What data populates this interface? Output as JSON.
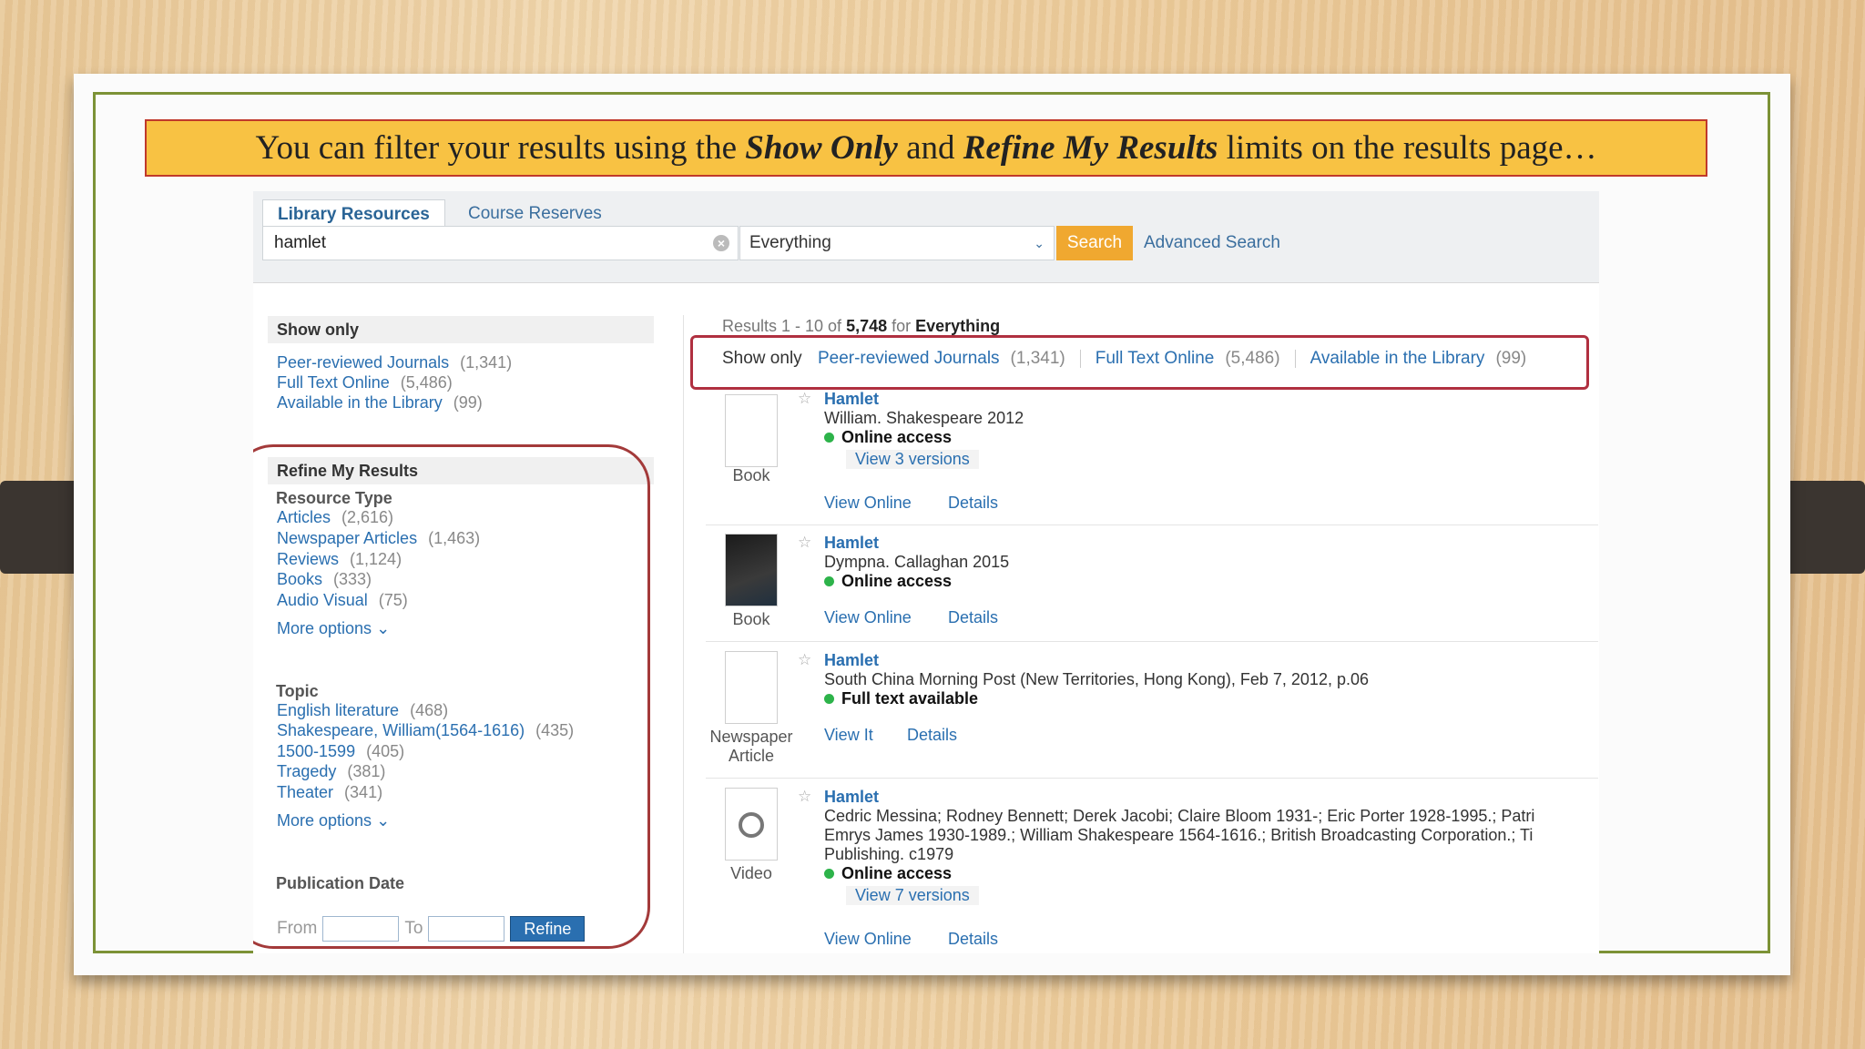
{
  "banner": {
    "pre": "You can filter your results using the ",
    "em1": "Show Only",
    "mid": " and ",
    "em2": "Refine My Results",
    "post": " limits on the results page…"
  },
  "tabs": {
    "active": "Library Resources",
    "inactive": "Course Reserves"
  },
  "search": {
    "query": "hamlet",
    "clear": "×",
    "scope": "Everything",
    "button": "Search",
    "advanced": "Advanced Search"
  },
  "show_only": {
    "heading": "Show only",
    "items": [
      {
        "label": "Peer-reviewed Journals",
        "count": "(1,341)"
      },
      {
        "label": "Full Text Online",
        "count": "(5,486)"
      },
      {
        "label": "Available in the Library",
        "count": "(99)"
      }
    ]
  },
  "refine": {
    "heading": "Refine My Results",
    "resource_type": {
      "label": "Resource Type",
      "items": [
        {
          "label": "Articles",
          "count": "(2,616)"
        },
        {
          "label": "Newspaper Articles",
          "count": "(1,463)"
        },
        {
          "label": "Reviews",
          "count": "(1,124)"
        },
        {
          "label": "Books",
          "count": "(333)"
        },
        {
          "label": "Audio Visual",
          "count": "(75)"
        }
      ],
      "more": "More options"
    },
    "topic": {
      "label": "Topic",
      "items": [
        {
          "label": "English literature",
          "count": "(468)"
        },
        {
          "label": "Shakespeare, William(1564-1616)",
          "count": "(435)"
        },
        {
          "label": "1500-1599",
          "count": "(405)"
        },
        {
          "label": "Tragedy",
          "count": "(381)"
        },
        {
          "label": "Theater",
          "count": "(341)"
        }
      ],
      "more": "More options"
    },
    "pub_date": {
      "label": "Publication Date",
      "from": "From",
      "to": "To",
      "button": "Refine"
    }
  },
  "results_header": {
    "prefix": "Results 1 - 10 of ",
    "total": "5,748",
    "mid": " for ",
    "scope": "Everything"
  },
  "results_show_only": {
    "label": "Show only",
    "items": [
      {
        "label": "Peer-reviewed Journals",
        "count": "(1,341)"
      },
      {
        "label": "Full Text Online",
        "count": "(5,486)"
      },
      {
        "label": "Available in the Library",
        "count": "(99)"
      }
    ]
  },
  "results": [
    {
      "title": "Hamlet",
      "lines": [
        "William. Shakespeare 2012"
      ],
      "status": "Online access",
      "versions": "View 3 versions",
      "type": "Book",
      "actions": [
        "View Online",
        "Details"
      ]
    },
    {
      "title": "Hamlet",
      "lines": [
        "Dympna. Callaghan 2015"
      ],
      "status": "Online access",
      "type": "Book",
      "actions": [
        "View Online",
        "Details"
      ]
    },
    {
      "title": "Hamlet",
      "lines": [
        "South China Morning Post (New Territories, Hong Kong), Feb 7, 2012, p.06"
      ],
      "status": "Full text available",
      "type_line1": "Newspaper",
      "type_line2": "Article",
      "actions": [
        "View It",
        "Details"
      ]
    },
    {
      "title": "Hamlet",
      "lines": [
        "Cedric Messina; Rodney Bennett; Derek Jacobi; Claire Bloom 1931-; Eric Porter 1928-1995.; Patri",
        "Emrys James 1930-1989.; William Shakespeare 1564-1616.; British Broadcasting Corporation.; Ti",
        "Publishing. c1979"
      ],
      "status": "Online access",
      "versions": "View 7 versions",
      "type": "Video",
      "actions": [
        "View Online",
        "Details"
      ]
    }
  ]
}
